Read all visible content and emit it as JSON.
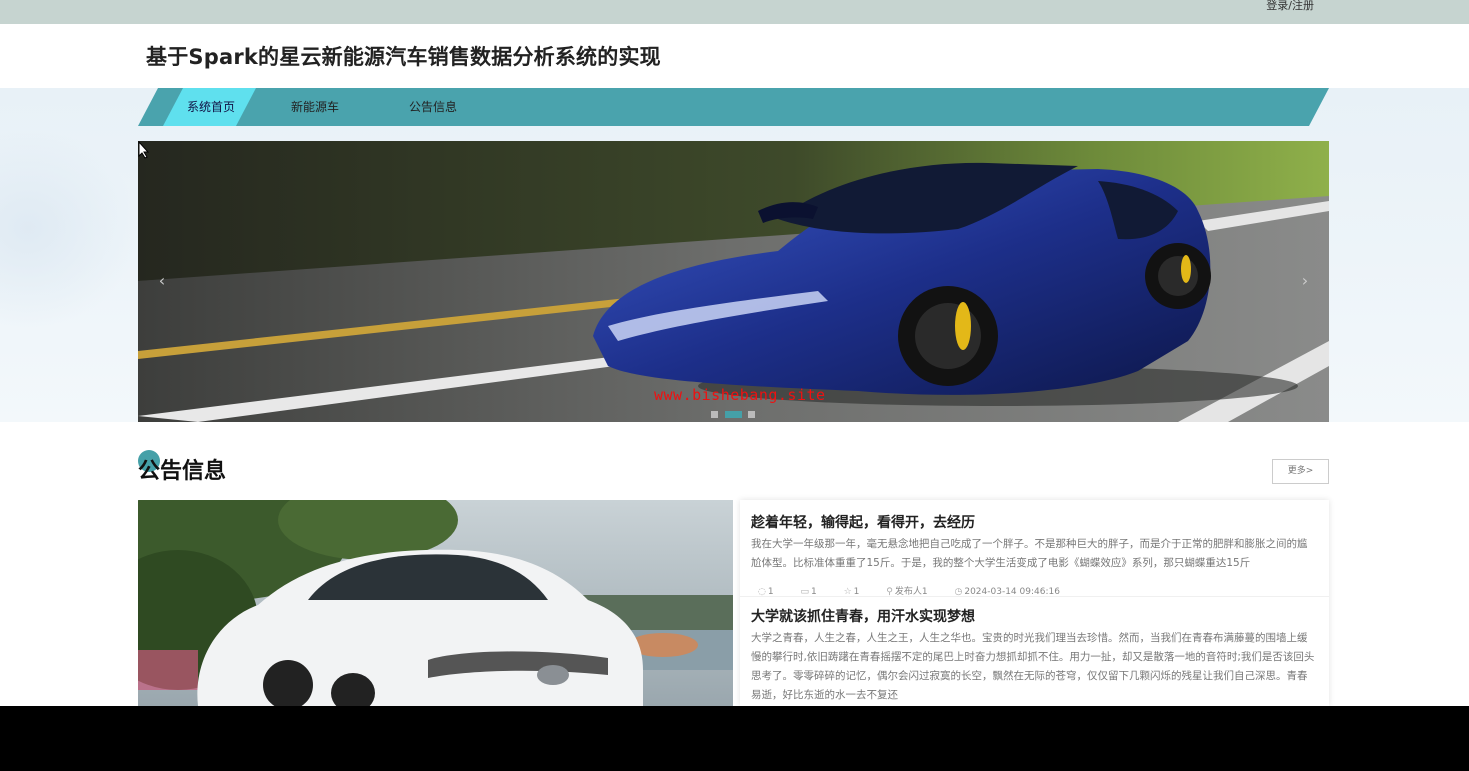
{
  "topbar": {
    "login_label": "登录/注册"
  },
  "header": {
    "title": "基于Spark的星云新能源汽车销售数据分析系统的实现"
  },
  "nav": {
    "items": [
      {
        "label": "系统首页"
      },
      {
        "label": "新能源车"
      },
      {
        "label": "公告信息"
      }
    ]
  },
  "carousel": {
    "watermark": "www.bishebang.site",
    "prev_icon": "chevron-left-icon",
    "next_icon": "chevron-right-icon",
    "active_slide": 2,
    "slide_count": 3
  },
  "announcements": {
    "title": "公告信息",
    "more_label": "更多>",
    "items": [
      {
        "title": "趁着年轻，输得起，看得开，去经历",
        "body": "我在大学一年级那一年，毫无悬念地把自己吃成了一个胖子。不是那种巨大的胖子，而是介于正常的肥胖和膨胀之间的尴尬体型。比标准体重重了15斤。于是，我的整个大学生活变成了电影《蝴蝶效应》系列，那只蝴蝶重达15斤",
        "meta": {
          "comments": "1",
          "views": "1",
          "likes": "1",
          "author": "发布人1",
          "time": "2024-03-14 09:46:16"
        }
      },
      {
        "title": "大学就该抓住青春，用汗水实现梦想",
        "body": "大学之青春，人生之春，人生之王，人生之华也。宝贵的时光我们理当去珍惜。然而，当我们在青春布满藤蔓的围墙上缓慢的攀行时,依旧踌躇在青春摇摆不定的尾巴上时奋力想抓却抓不住。用力一扯，却又是散落一地的音符时;我们是否该回头思考了。零零碎碎的记忆，偶尔会闪过寂寞的长空，飘然在无际的苍穹，仅仅留下几颗闪烁的残星让我们自己深思。青春易逝，好比东逝的水一去不复还"
      }
    ]
  },
  "colors": {
    "nav_teal": "#4aa3ad",
    "nav_active": "#5fe0ee",
    "section_accent": "#45a0a8",
    "watermark": "#ee1111"
  }
}
